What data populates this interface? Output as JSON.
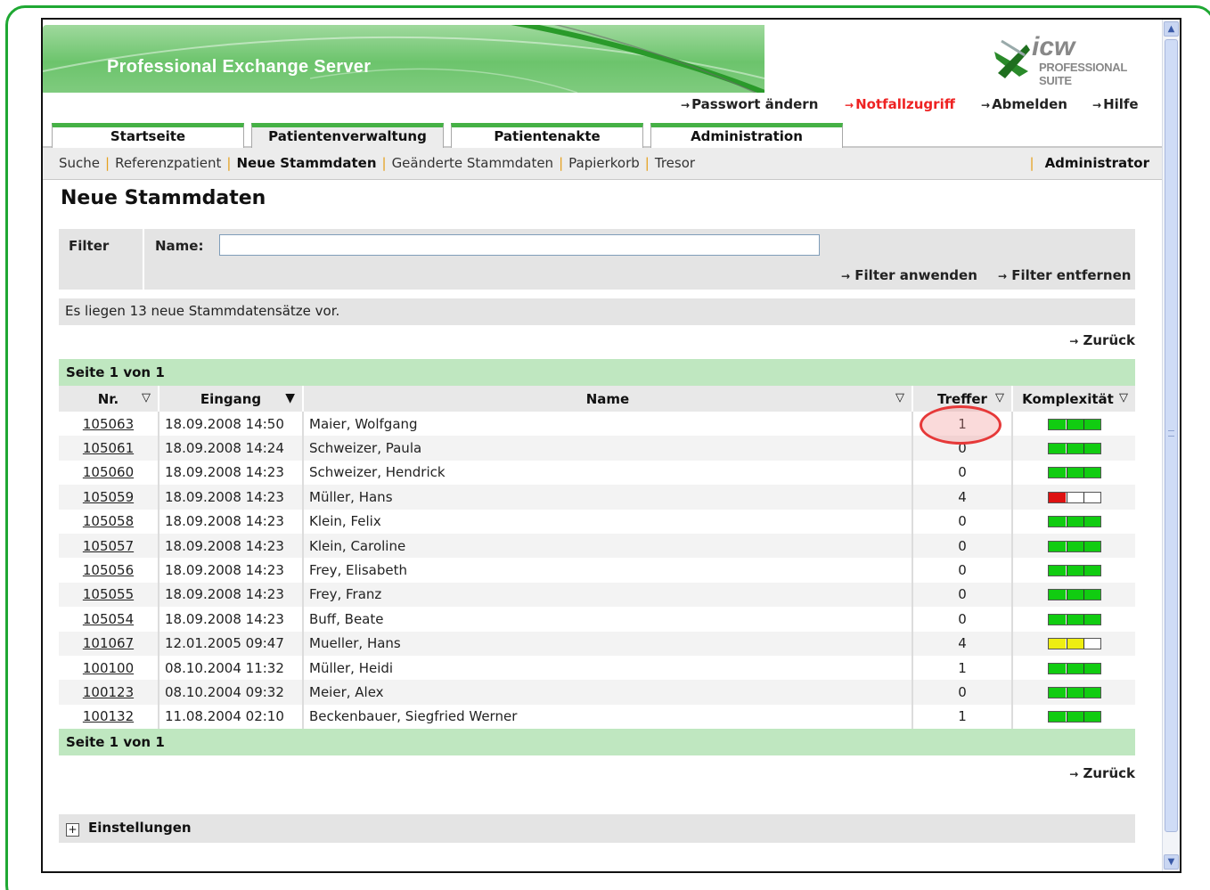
{
  "header": {
    "title": "Professional Exchange Server",
    "logo_main": "icw",
    "logo_sub": "PROFESSIONAL SUITE"
  },
  "toplinks": [
    {
      "label": "Passwort ändern",
      "color": "#222222"
    },
    {
      "label": "Notfallzugriff",
      "color": "#e22222"
    },
    {
      "label": "Abmelden",
      "color": "#222222"
    },
    {
      "label": "Hilfe",
      "color": "#222222"
    }
  ],
  "tabs": [
    {
      "label": "Startseite",
      "active": false
    },
    {
      "label": "Patientenverwaltung",
      "active": true
    },
    {
      "label": "Patientenakte",
      "active": false
    },
    {
      "label": "Administration",
      "active": false
    }
  ],
  "subnav": {
    "items": [
      "Suche",
      "Referenzpatient",
      "Neue Stammdaten",
      "Geänderte Stammdaten",
      "Papierkorb",
      "Tresor"
    ],
    "active": "Neue Stammdaten",
    "user": "Administrator"
  },
  "page_title": "Neue Stammdaten",
  "filter": {
    "label": "Filter",
    "name_label": "Name:",
    "name_value": "",
    "apply": "Filter anwenden",
    "remove": "Filter entfernen"
  },
  "info_text": "Es liegen 13 neue Stammdatensätze vor.",
  "back_label": "Zurück",
  "pager_text": "Seite 1 von 1",
  "table": {
    "columns": [
      "Nr.",
      "Eingang",
      "Name",
      "Treffer",
      "Komplexität"
    ],
    "rows": [
      {
        "nr": "105063",
        "eingang": "18.09.2008 14:50",
        "name": "Maier, Wolfgang",
        "treffer": "1",
        "complexity": "green"
      },
      {
        "nr": "105061",
        "eingang": "18.09.2008 14:24",
        "name": "Schweizer, Paula",
        "treffer": "0",
        "complexity": "green"
      },
      {
        "nr": "105060",
        "eingang": "18.09.2008 14:23",
        "name": "Schweizer, Hendrick",
        "treffer": "0",
        "complexity": "green"
      },
      {
        "nr": "105059",
        "eingang": "18.09.2008 14:23",
        "name": "Müller, Hans",
        "treffer": "4",
        "complexity": "red"
      },
      {
        "nr": "105058",
        "eingang": "18.09.2008 14:23",
        "name": "Klein, Felix",
        "treffer": "0",
        "complexity": "green"
      },
      {
        "nr": "105057",
        "eingang": "18.09.2008 14:23",
        "name": "Klein, Caroline",
        "treffer": "0",
        "complexity": "green"
      },
      {
        "nr": "105056",
        "eingang": "18.09.2008 14:23",
        "name": "Frey, Elisabeth",
        "treffer": "0",
        "complexity": "green"
      },
      {
        "nr": "105055",
        "eingang": "18.09.2008 14:23",
        "name": "Frey, Franz",
        "treffer": "0",
        "complexity": "green"
      },
      {
        "nr": "105054",
        "eingang": "18.09.2008 14:23",
        "name": "Buff, Beate",
        "treffer": "0",
        "complexity": "green"
      },
      {
        "nr": "101067",
        "eingang": "12.01.2005 09:47",
        "name": "Mueller, Hans",
        "treffer": "4",
        "complexity": "yellow"
      },
      {
        "nr": "100100",
        "eingang": "08.10.2004 11:32",
        "name": "Müller, Heidi",
        "treffer": "1",
        "complexity": "green"
      },
      {
        "nr": "100123",
        "eingang": "08.10.2004 09:32",
        "name": "Meier, Alex",
        "treffer": "0",
        "complexity": "green"
      },
      {
        "nr": "100132",
        "eingang": "11.08.2004 02:10",
        "name": "Beckenbauer, Siegfried Werner",
        "treffer": "1",
        "complexity": "green"
      }
    ]
  },
  "settings_label": "Einstellungen",
  "colors": {
    "accent_green": "#45b145",
    "complexity_green": "#11cc11",
    "complexity_red": "#dd1111",
    "complexity_yellow": "#eeee11",
    "highlight": "#e63939"
  }
}
